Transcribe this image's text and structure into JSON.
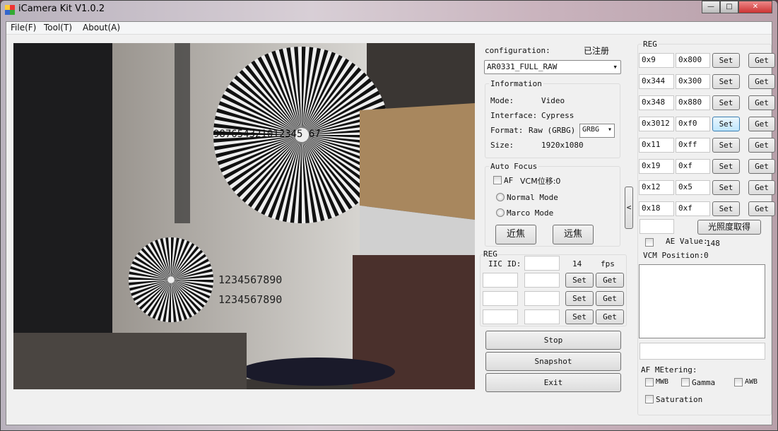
{
  "window": {
    "title": "iCamera Kit V1.0.2",
    "minimize": "—",
    "maximize": "□",
    "close": "✕"
  },
  "menu": [
    "File(F)",
    "Tool(T)",
    "About(A)"
  ],
  "config": {
    "label": "configuration:",
    "status": "已注册",
    "selected": "AR0331_FULL_RAW"
  },
  "info": {
    "title": "Information",
    "mode_label": "Mode:",
    "mode": "Video",
    "interface_label": "Interface:",
    "interface": "Cypress",
    "format_label": "Format:",
    "format": "Raw (GRBG)",
    "bayer": "GRBG",
    "size_label": "Size:",
    "size": "1920x1080"
  },
  "af": {
    "title": "Auto Focus",
    "af_label": "AF",
    "vcm": "VCM位移:0",
    "normal": "Normal Mode",
    "marco": "Marco Mode",
    "near": "近焦",
    "far": "远焦"
  },
  "reg_small": {
    "title": "REG",
    "iic_label": "IIC ID:",
    "iic": "",
    "fps_value": "14",
    "fps_label": "fps",
    "rows": [
      {
        "addr": "",
        "val": ""
      },
      {
        "addr": "",
        "val": ""
      },
      {
        "addr": "",
        "val": ""
      }
    ]
  },
  "buttons": {
    "set": "Set",
    "get": "Get",
    "stop": "Stop",
    "snapshot": "Snapshot",
    "exit": "Exit",
    "collapse": "<"
  },
  "reg": {
    "title": "REG",
    "rows": [
      {
        "addr": "0x9",
        "val": "0x800"
      },
      {
        "addr": "0x344",
        "val": "0x300"
      },
      {
        "addr": "0x348",
        "val": "0x880"
      },
      {
        "addr": "0x3012",
        "val": "0xf0"
      },
      {
        "addr": "0x11",
        "val": "0xff"
      },
      {
        "addr": "0x19",
        "val": "0xf"
      },
      {
        "addr": "0x12",
        "val": "0x5"
      },
      {
        "addr": "0x18",
        "val": "0xf"
      }
    ],
    "lux_input": "",
    "lux_button": "光照度取得"
  },
  "ae": {
    "label": "AE Value:",
    "value": "148",
    "vcm_label": "VCM Position:",
    "vcm_value": "0",
    "log": "",
    "status": ""
  },
  "metering": {
    "title": "AF MEtering:",
    "mwb": "MWB",
    "gamma": "Gamma",
    "awb": "AWB",
    "saturation": "Saturation"
  },
  "camera": {
    "chart_numbers": "987654321012345 67",
    "row1": "1234567890",
    "row2": "1234567890"
  }
}
